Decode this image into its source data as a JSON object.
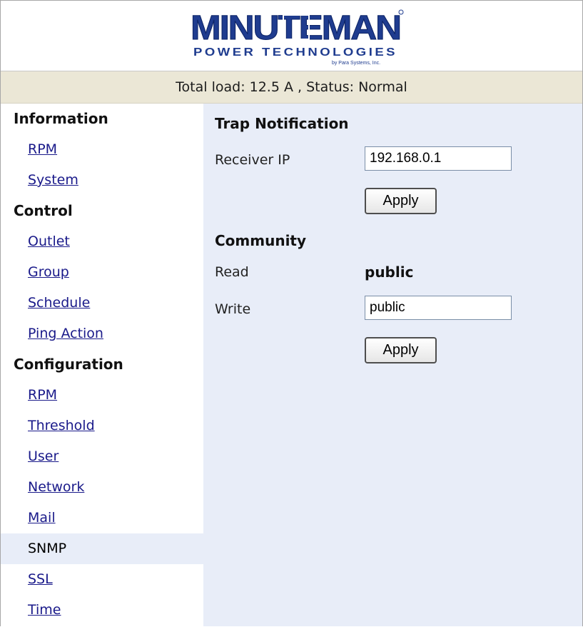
{
  "header": {
    "logo_main": "MINUTEMAN",
    "logo_sub": "POWER TECHNOLOGIES",
    "logo_tag": "by Para Systems, Inc."
  },
  "statusbar": {
    "text": "Total load: 12.5 A , Status: Normal"
  },
  "sidebar": {
    "sections": [
      {
        "title": "Information",
        "items": [
          {
            "label": "RPM"
          },
          {
            "label": "System"
          }
        ]
      },
      {
        "title": "Control",
        "items": [
          {
            "label": "Outlet"
          },
          {
            "label": "Group"
          },
          {
            "label": "Schedule"
          },
          {
            "label": "Ping Action"
          }
        ]
      },
      {
        "title": "Configuration",
        "items": [
          {
            "label": "RPM"
          },
          {
            "label": "Threshold"
          },
          {
            "label": "User"
          },
          {
            "label": "Network"
          },
          {
            "label": "Mail"
          },
          {
            "label": "SNMP",
            "active": true
          },
          {
            "label": "SSL"
          },
          {
            "label": "Time"
          }
        ]
      }
    ]
  },
  "main": {
    "trap": {
      "heading": "Trap Notification",
      "receiver_label": "Receiver IP",
      "receiver_value": "192.168.0.1",
      "apply_label": "Apply"
    },
    "community": {
      "heading": "Community",
      "read_label": "Read",
      "read_value": "public",
      "write_label": "Write",
      "write_value": "public",
      "apply_label": "Apply"
    }
  },
  "colors": {
    "link": "#1a1a8a",
    "status_bg": "#ebe7d6",
    "panel_bg": "#e8edf8",
    "logo_blue": "#1f3c8f"
  }
}
